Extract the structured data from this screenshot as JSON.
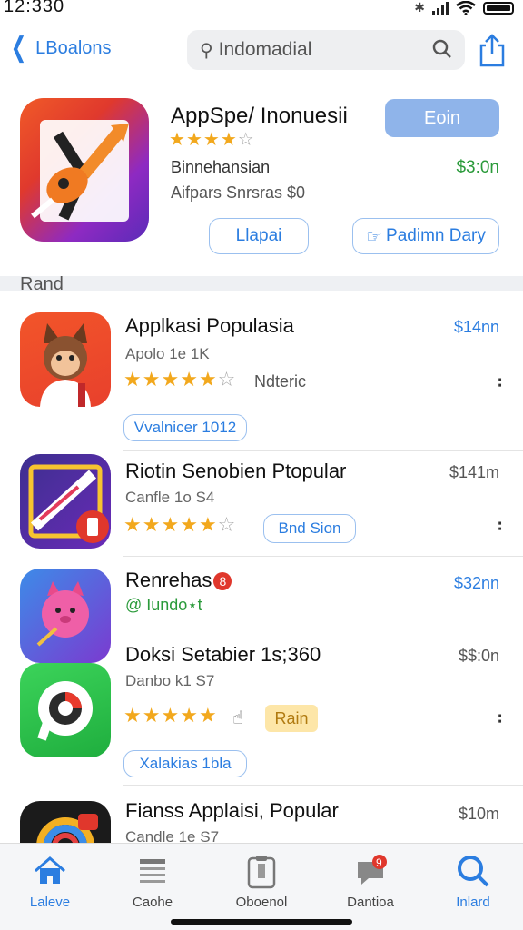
{
  "status": {
    "time": "12:330"
  },
  "nav": {
    "back_label": "LBoalons",
    "search_value": "Indomadial",
    "search_placeholder": "Indomadial"
  },
  "featured": {
    "title": "AppSpe/ Inonuesii",
    "rating": 4.5,
    "category": "Binnehansian",
    "price": "$3:0n",
    "description": "Aifpars Snrsras $0",
    "get_label": "Eoin",
    "button_left": "Llapai",
    "button_right": "Padimn Dary"
  },
  "section": {
    "title": "Rand"
  },
  "rows": [
    {
      "name": "Applkasi  Populasia",
      "price": "$14nn",
      "sub": "Apolo 1e 1K",
      "rating": 4.5,
      "tag": "Ndteric",
      "pill": "Vvalnicer   1012"
    },
    {
      "name": "Riotin Senobien Ptopular",
      "price": "$141m",
      "sub": "Canfle 1o S4",
      "rating": 4.5,
      "pill": "Bnd Sion"
    },
    {
      "name": "Renrehas",
      "badge": "8",
      "price": "$32nn",
      "sub": "@ Iundo⋆t"
    },
    {
      "name": "Doksi Setabier  1s;360",
      "price": "$$:0n",
      "sub": "Danbo k1 S7",
      "rating": 4.0,
      "tag": "Rain",
      "pill": "Xalakias   1bla"
    },
    {
      "name": "Fianss Applaisi, Popular",
      "price": "$10m",
      "sub": "Candle 1e S7"
    }
  ],
  "tabs": [
    {
      "label": "Laleve",
      "icon": "home-icon",
      "active": true
    },
    {
      "label": "Caohe",
      "icon": "list-icon",
      "active": false
    },
    {
      "label": "Oboenol",
      "icon": "clipboard-icon",
      "active": false
    },
    {
      "label": "Dantioa",
      "icon": "chat-icon",
      "active": false,
      "badge": "9"
    },
    {
      "label": "Inlard",
      "icon": "search-icon",
      "active": true
    }
  ],
  "colors": {
    "accent": "#2b7de0",
    "price_green": "#2a9a3a",
    "star": "#f2a81d",
    "get_button": "#8fb4ea"
  }
}
